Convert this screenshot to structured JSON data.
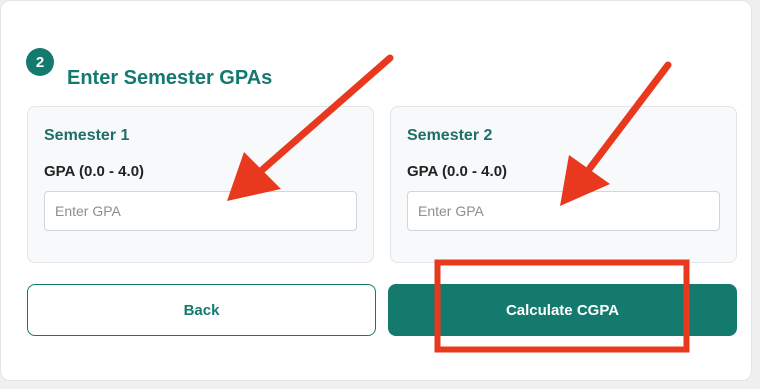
{
  "step": {
    "number": "2",
    "title": "Enter Semester GPAs"
  },
  "semesters": [
    {
      "title": "Semester 1",
      "gpa_label": "GPA (0.0 - 4.0)",
      "placeholder": "Enter GPA",
      "value": ""
    },
    {
      "title": "Semester 2",
      "gpa_label": "GPA (0.0 - 4.0)",
      "placeholder": "Enter GPA",
      "value": ""
    }
  ],
  "buttons": {
    "back": "Back",
    "calculate": "Calculate CGPA"
  },
  "colors": {
    "accent": "#147a6e",
    "annotation": "#e8391f"
  }
}
